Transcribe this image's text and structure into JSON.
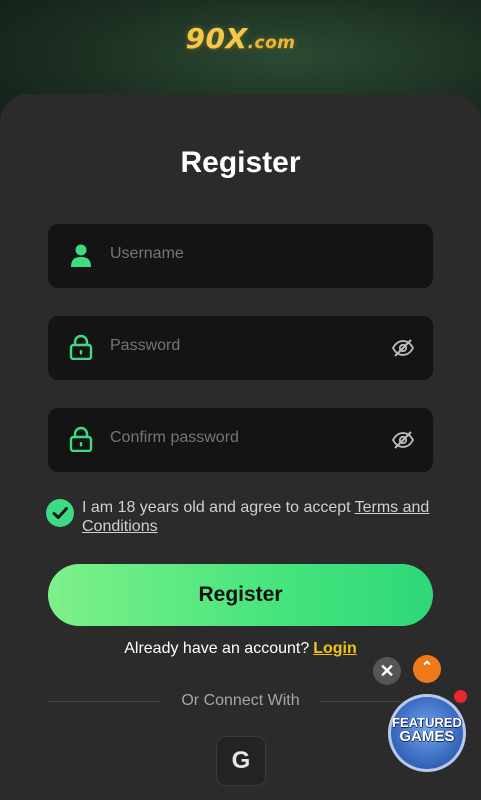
{
  "brand": {
    "logo_part1": "90",
    "logo_part2": "X",
    "logo_part3": ".com"
  },
  "form": {
    "title": "Register",
    "username": {
      "placeholder": "Username",
      "icon": "user-icon"
    },
    "password": {
      "placeholder": "Password",
      "icon": "lock-icon",
      "toggle_icon": "eye-off-icon"
    },
    "confirm_password": {
      "placeholder": "Confirm password",
      "icon": "lock-icon",
      "toggle_icon": "eye-off-icon"
    },
    "agree_text": "I am 18 years old and agree to accept",
    "terms_link": "Terms and Conditions",
    "agree_checked": true,
    "register_label": "Register",
    "already_text": "Already have an account?",
    "login_link": "Login",
    "connect_text": "Or Connect With",
    "google_glyph": "G"
  },
  "floating": {
    "close_glyph": "✕",
    "up_glyph": "⌃",
    "featured_line1": "FEATURED",
    "featured_line2": "GAMES"
  },
  "colors": {
    "accent_green": "#3ddc84",
    "login_link": "#f0c419",
    "card_bg": "#2b2b2b",
    "field_bg": "#141414"
  }
}
